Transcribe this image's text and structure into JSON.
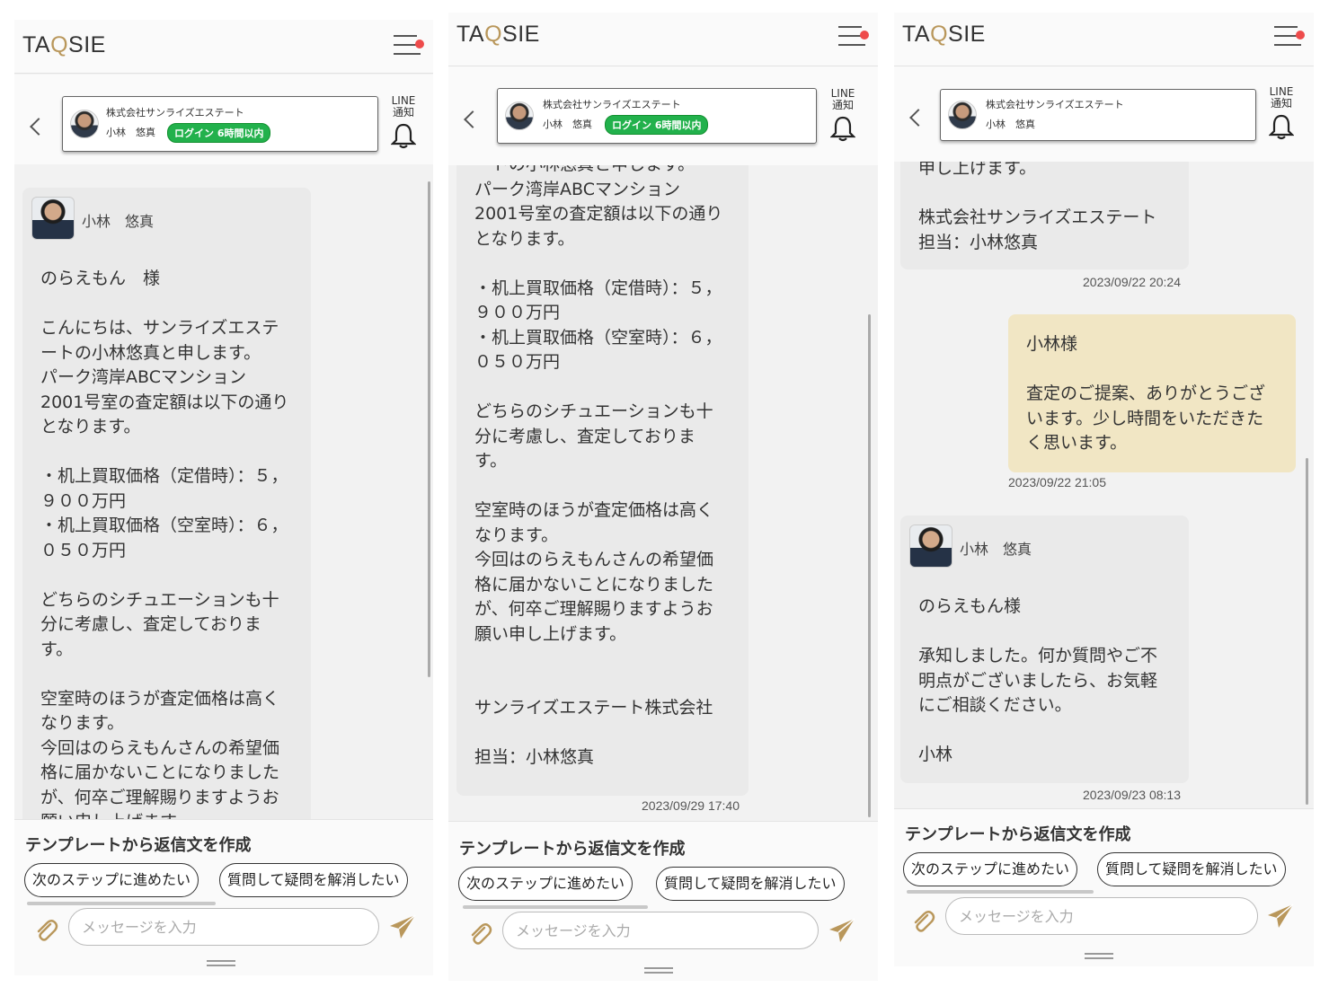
{
  "app": {
    "logo_left": "TA",
    "logo_q": "Q",
    "logo_right": "SIE"
  },
  "contact": {
    "company": "株式会社サンライズエステート",
    "person": "小林　悠真",
    "login_badge": "ログイン 6時間以内"
  },
  "line_notify": {
    "line1": "LINE",
    "line2": "通知"
  },
  "sender": {
    "name": "小林　悠真"
  },
  "screens": {
    "s1": {
      "message": "のらえもん　様\n\nこんにちは、サンライズエステ\nートの小林悠真と申します。\nパーク湾岸ABCマンション\n2001号室の査定額は以下の通り\nとなります。\n\n・机上買取価格（定借時）：５，\n９００万円\n・机上買取価格（空室時）：６，\n０５０万円\n\nどちらのシチュエーションも十\n分に考慮し、査定しておりま\nす。\n\n空室時のほうが査定価格は高く\nなります。\n今回はのらえもんさんの希望価\n格に届かないことになりました\nが、何卒ご理解賜りますようお\n願い申し上げます。"
    },
    "s2": {
      "message": "ートの小林悠真と申します。\nパーク湾岸ABCマンション\n2001号室の査定額は以下の通り\nとなります。\n\n・机上買取価格（定借時）：５，\n９００万円\n・机上買取価格（空室時）：６，\n０５０万円\n\nどちらのシチュエーションも十\n分に考慮し、査定しておりま\nす。\n\n空室時のほうが査定価格は高く\nなります。\n今回はのらえもんさんの希望価\n格に届かないことになりました\nが、何卒ご理解賜りますようお\n願い申し上げます。\n\n\nサンライズエステート株式会社\n\n担当：小林悠真",
      "timestamp": "2023/09/29 17:40"
    },
    "s3": {
      "message_top": "申し上げます。\n\n株式会社サンライズエステート\n担当：小林悠真",
      "timestamp_top": "2023/09/22 20:24",
      "my_message": "小林様\n\n査定のご提案、ありがとうござ\nいます。少し時間をいただきた\nく思います。",
      "timestamp_mine": "2023/09/22 21:05",
      "reply": "のらえもん様\n\n承知しました。何か質問やご不\n明点がございましたら、お気軽\nにご相談ください。\n\n小林",
      "timestamp_reply": "2023/09/23 08:13"
    }
  },
  "footer": {
    "template_title": "テンプレートから返信文を作成",
    "chip1": "次のステップに進めたい",
    "chip2": "質問して疑問を解消したい",
    "input_placeholder": "メッセージを入力"
  },
  "colors": {
    "accent_gold": "#b9975b",
    "badge_green": "#22b14c",
    "notify_red": "#ee4b4b",
    "my_bubble": "#f1e6c4"
  },
  "icons": [
    "menu-icon",
    "back-icon",
    "bell-icon",
    "paperclip-icon",
    "send-icon",
    "avatar"
  ]
}
